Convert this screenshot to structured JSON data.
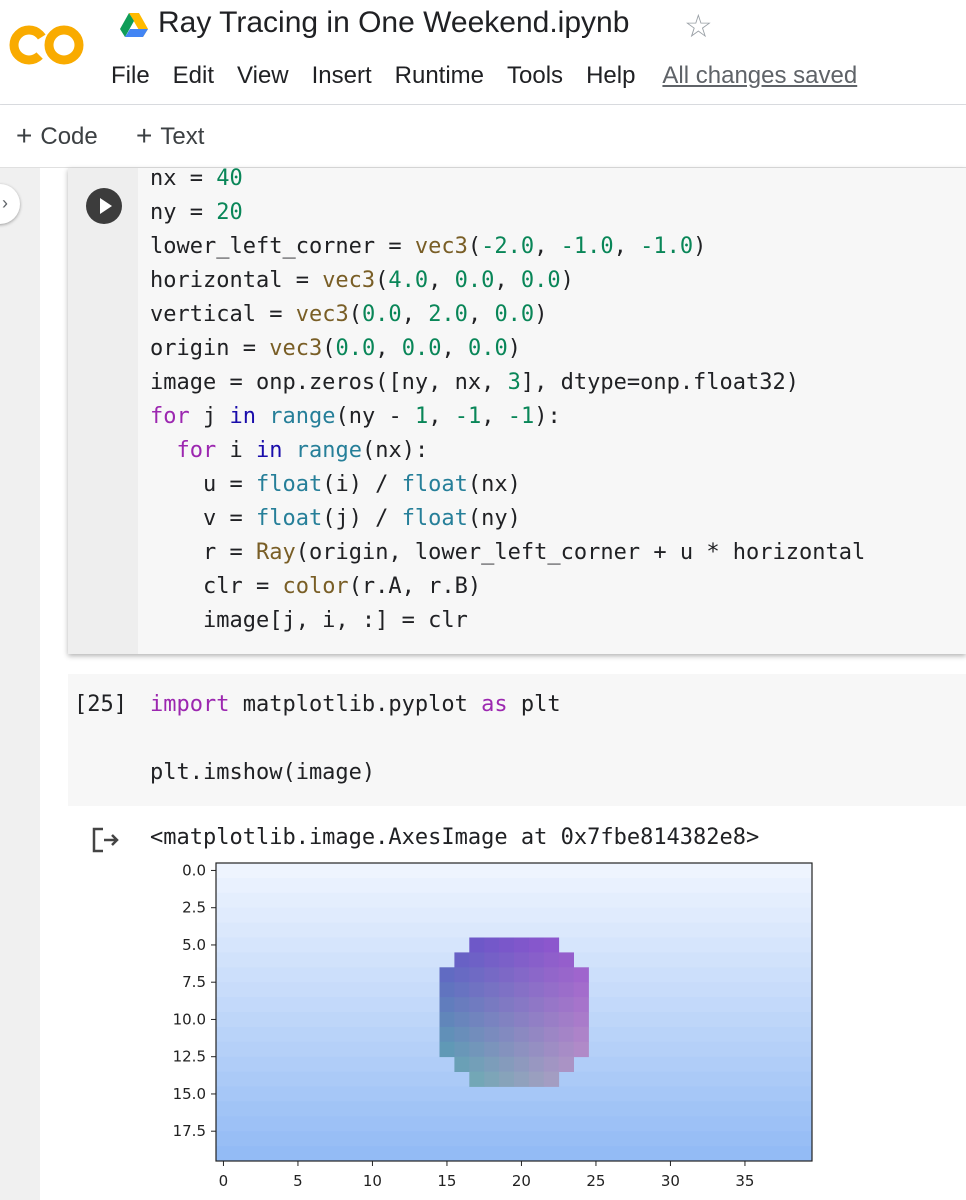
{
  "header": {
    "title": "Ray Tracing in One Weekend.ipynb",
    "menu": [
      "File",
      "Edit",
      "View",
      "Insert",
      "Runtime",
      "Tools",
      "Help"
    ],
    "save_status": "All changes saved",
    "logo_color": "#F9AB00"
  },
  "toolbar": {
    "code_label": "Code",
    "text_label": "Text",
    "plus": "+"
  },
  "cell1": {
    "lines": [
      "nx = 40",
      "ny = 20",
      "lower_left_corner = vec3(-2.0, -1.0, -1.0)",
      "horizontal = vec3(4.0, 0.0, 0.0)",
      "vertical = vec3(0.0, 2.0, 0.0)",
      "origin = vec3(0.0, 0.0, 0.0)",
      "image = onp.zeros([ny, nx, 3], dtype=onp.float32)",
      "for j in range(ny - 1, -1, -1):",
      "  for i in range(nx):",
      "    u = float(i) / float(nx)",
      "    v = float(j) / float(ny)",
      "    r = Ray(origin, lower_left_corner + u * horizontal",
      "    clr = color(r.A, r.B)",
      "    image[j, i, :] = clr"
    ]
  },
  "cell2": {
    "exec_count": "[25]",
    "lines": [
      "import matplotlib.pyplot as plt",
      "",
      "plt.imshow(image)"
    ]
  },
  "output": {
    "text": "<matplotlib.image.AxesImage at 0x7fbe814382e8>"
  },
  "chart_data": {
    "type": "heatmap",
    "image_width": 40,
    "image_height": 20,
    "xlim": [
      -0.5,
      39.5
    ],
    "ylim": [
      19.5,
      -0.5
    ],
    "xticks": [
      0,
      5,
      10,
      15,
      20,
      25,
      30,
      35
    ],
    "xtick_labels": [
      "0",
      "5",
      "10",
      "15",
      "20",
      "25",
      "30",
      "35"
    ],
    "yticks": [
      0,
      2.5,
      5,
      7.5,
      10,
      12.5,
      15,
      17.5
    ],
    "ytick_labels": [
      "0.0",
      "2.5",
      "5.0",
      "7.5",
      "10.0",
      "12.5",
      "15.0",
      "17.5"
    ],
    "background_gradient": [
      "#eef4fe",
      "#93bbf5"
    ],
    "sphere": {
      "center_x": 19.5,
      "center_y": 9.5,
      "radius_px": 5.5
    },
    "sphere_colors": {
      "top_left": "#5c4fc8",
      "top_right": "#9b4fd0",
      "bottom_left": "#56b7ac",
      "bottom_right": "#c49ec8"
    }
  }
}
